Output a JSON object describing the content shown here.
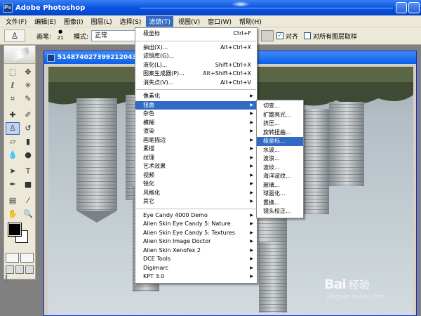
{
  "app": {
    "title": "Adobe Photoshop"
  },
  "menubar": {
    "items": [
      {
        "label": "文件(F)"
      },
      {
        "label": "编辑(E)"
      },
      {
        "label": "图像(I)"
      },
      {
        "label": "图层(L)"
      },
      {
        "label": "选择(S)"
      },
      {
        "label": "滤镜(T)"
      },
      {
        "label": "视图(V)"
      },
      {
        "label": "窗口(W)"
      },
      {
        "label": "帮助(H)"
      }
    ]
  },
  "options": {
    "brush_label": "画笔:",
    "brush_size": "21",
    "mode_label": "模式:",
    "mode_value": "正常",
    "aligned_label": "对齐",
    "sample_all_label": "对所有图层取样"
  },
  "document": {
    "title": "5148740273992120430.jp"
  },
  "filter_menu": {
    "top_items": [
      {
        "label": "极坐标",
        "shortcut": "Ctrl+F"
      }
    ],
    "tool_items": [
      {
        "label": "抽出(X)...",
        "shortcut": "Alt+Ctrl+X"
      },
      {
        "label": "滤镜库(G)...",
        "shortcut": ""
      },
      {
        "label": "液化(L)...",
        "shortcut": "Shift+Ctrl+X"
      },
      {
        "label": "图案生成器(P)...",
        "shortcut": "Alt+Shift+Ctrl+X"
      },
      {
        "label": "消失点(V)...",
        "shortcut": "Alt+Ctrl+V"
      }
    ],
    "category_items": [
      {
        "label": "像素化"
      },
      {
        "label": "扭曲",
        "highlighted": true
      },
      {
        "label": "杂色"
      },
      {
        "label": "模糊"
      },
      {
        "label": "渲染"
      },
      {
        "label": "画笔描边"
      },
      {
        "label": "素描"
      },
      {
        "label": "纹理"
      },
      {
        "label": "艺术效果"
      },
      {
        "label": "视频"
      },
      {
        "label": "锐化"
      },
      {
        "label": "风格化"
      },
      {
        "label": "其它"
      }
    ],
    "plugin_items": [
      {
        "label": "Eye Candy 4000 Demo"
      },
      {
        "label": "Alien Skin Eye Candy 5: Nature"
      },
      {
        "label": "Alien Skin Eye Candy 5: Textures"
      },
      {
        "label": "Alien Skin Image Doctor"
      },
      {
        "label": "Alien Skin Xenofex 2"
      },
      {
        "label": "DCE Tools"
      },
      {
        "label": "Digimarc"
      },
      {
        "label": "KPT 3.0"
      }
    ]
  },
  "distort_menu": {
    "items": [
      {
        "label": "切变..."
      },
      {
        "label": "扩散亮光..."
      },
      {
        "label": "挤压..."
      },
      {
        "label": "旋转扭曲..."
      },
      {
        "label": "极坐标...",
        "highlighted": true
      },
      {
        "label": "水波..."
      },
      {
        "label": "波浪..."
      },
      {
        "label": "波纹..."
      },
      {
        "label": "海洋波纹..."
      },
      {
        "label": "玻璃..."
      },
      {
        "label": "球面化..."
      },
      {
        "label": "置换..."
      },
      {
        "label": "镜头校正..."
      }
    ]
  },
  "watermark": {
    "logo_left": "Bai",
    "logo_right": "经验",
    "url": "jingyan.baidu.com"
  },
  "colors": {
    "title_bar": "#0a54e2",
    "menu_highlight": "#316ac5",
    "chrome": "#ece9d8",
    "foreground_color": "#000000",
    "background_color": "#ffffff"
  }
}
